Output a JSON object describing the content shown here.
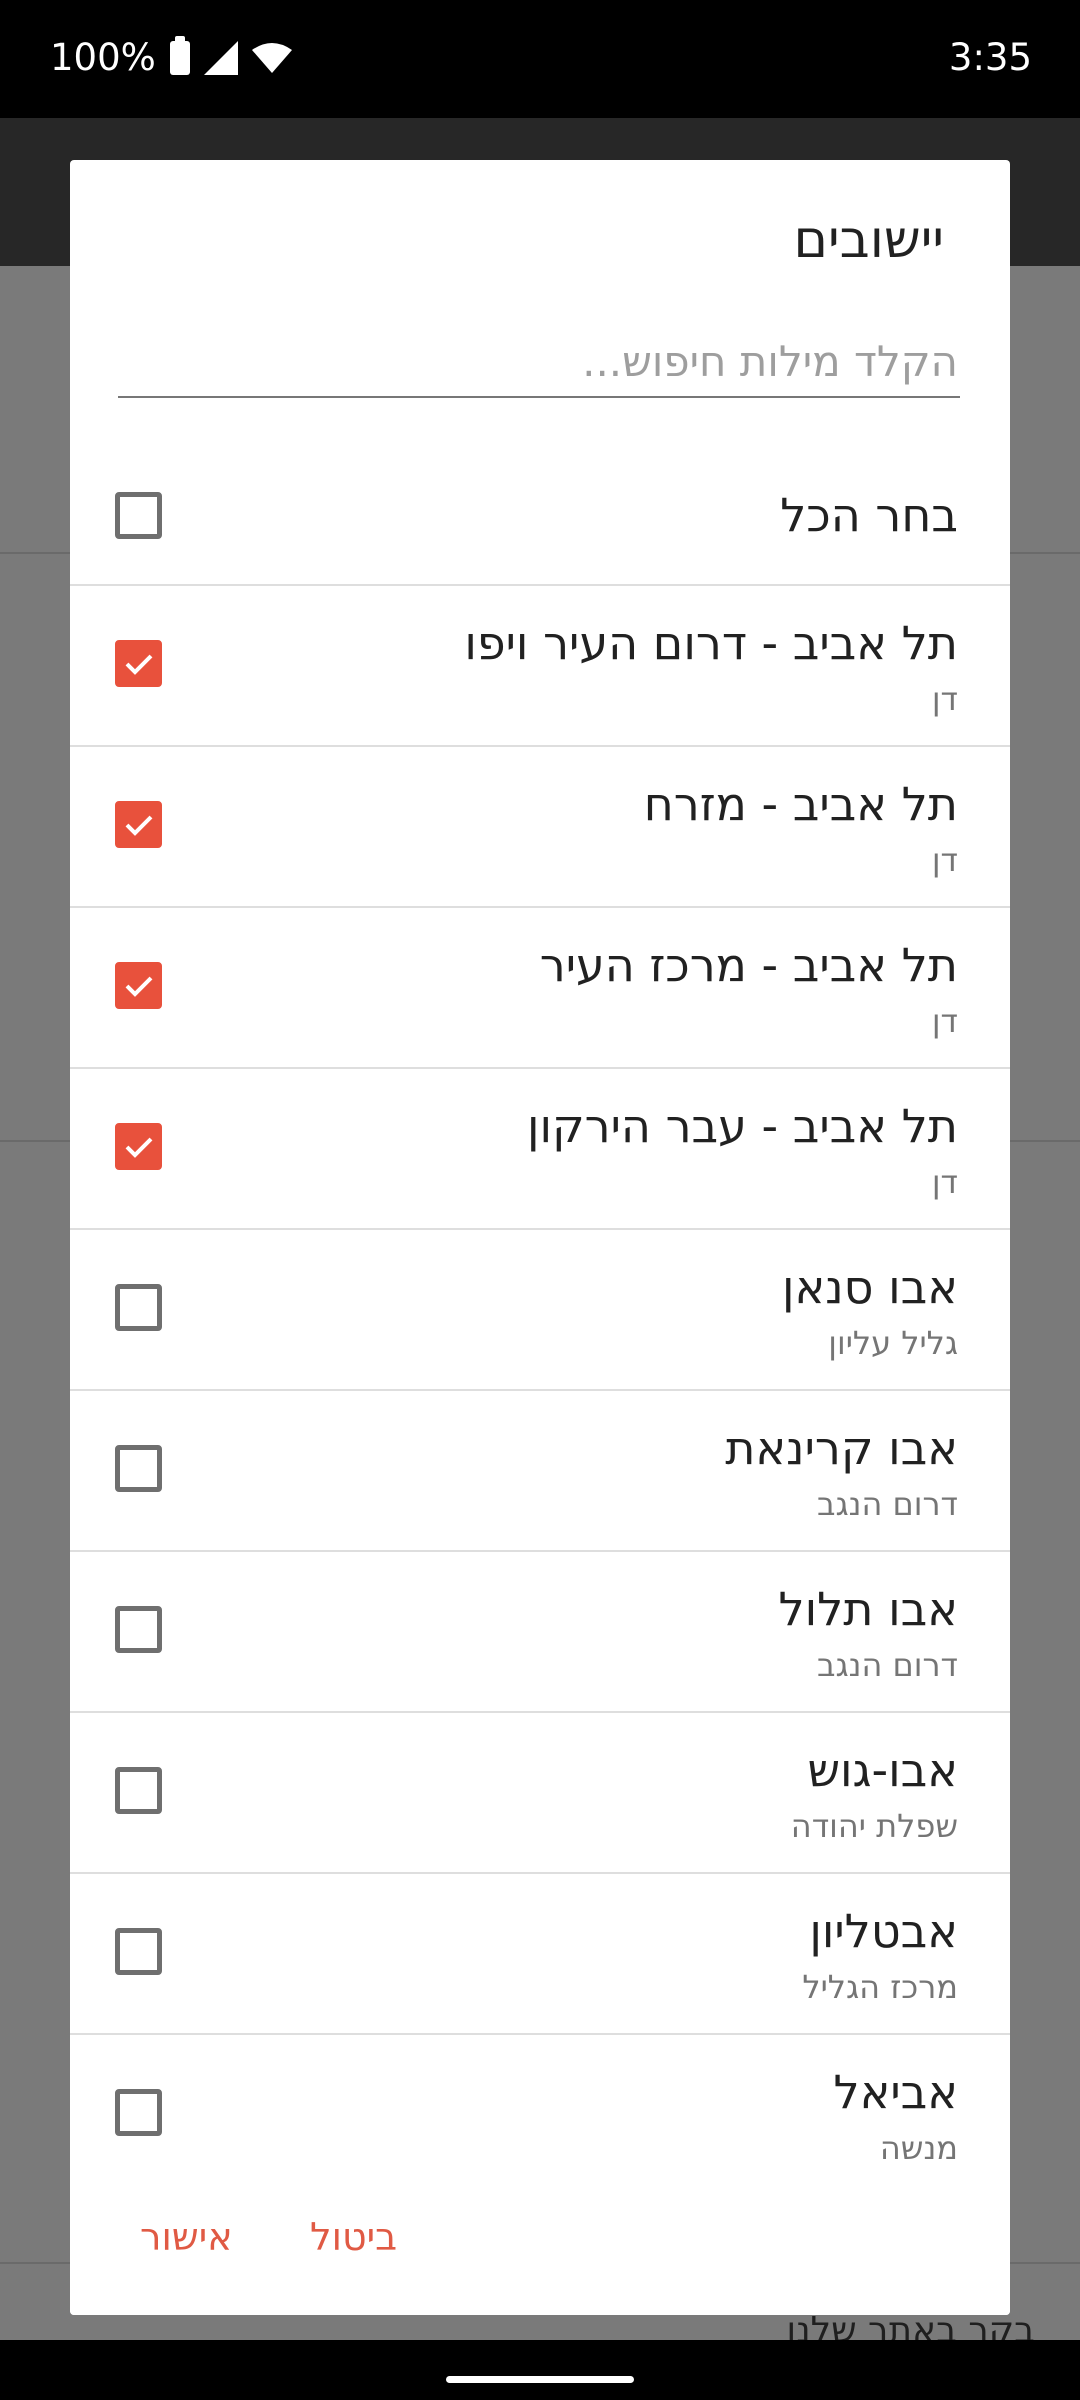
{
  "status_bar": {
    "battery_percent": "100%",
    "time": "3:35"
  },
  "dialog": {
    "title": "יישובים",
    "search_placeholder": "הקלד מילות חיפוש...",
    "select_all_label": "בחר הכל",
    "select_all_checked": false,
    "items": [
      {
        "title": "תל אביב - דרום העיר ויפו",
        "subtitle": "דן",
        "checked": true
      },
      {
        "title": "תל אביב - מזרח",
        "subtitle": "דן",
        "checked": true
      },
      {
        "title": "תל אביב - מרכז העיר",
        "subtitle": "דן",
        "checked": true
      },
      {
        "title": "תל אביב - עבר הירקון",
        "subtitle": "דן",
        "checked": true
      },
      {
        "title": "אבו סנאן",
        "subtitle": "גליל עליון",
        "checked": false
      },
      {
        "title": "אבו קרינאת",
        "subtitle": "דרום הנגב",
        "checked": false
      },
      {
        "title": "אבו תלול",
        "subtitle": "דרום הנגב",
        "checked": false
      },
      {
        "title": "אבו-גוש",
        "subtitle": "שפלת יהודה",
        "checked": false
      },
      {
        "title": "אבטליון",
        "subtitle": "מרכז הגליל",
        "checked": false
      },
      {
        "title": "אביאל",
        "subtitle": "מנשה",
        "checked": false
      }
    ],
    "ok_label": "אישור",
    "cancel_label": "ביטול"
  },
  "background": {
    "footer_link": "בקר באתר שלנו"
  },
  "colors": {
    "accent": "#e8513c",
    "action_text": "#e05a44",
    "scrim": "#7a7a7a"
  }
}
